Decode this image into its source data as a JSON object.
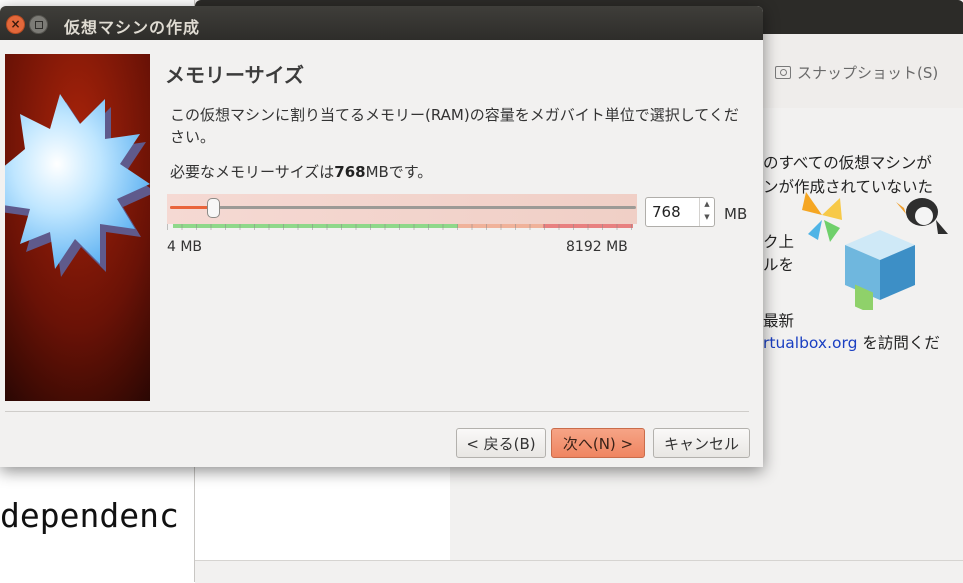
{
  "background": {
    "terminal_text": "dependenc",
    "toolbar_snapshot_label": "スナップショット(S)",
    "welcome_lines": [
      "のすべての仮想マシンが",
      "ンが作成されていないた",
      "ク上",
      "ルを",
      "最新"
    ],
    "welcome_link": "rtualbox.org",
    "welcome_link_suffix": " を訪問くだ"
  },
  "dialog": {
    "title": "仮想マシンの作成",
    "heading": "メモリーサイズ",
    "description": "この仮想マシンに割り当てるメモリー(RAM)の容量をメガバイト単位で選択してください。",
    "recommended_prefix": "必要なメモリーサイズは",
    "recommended_value": "768",
    "recommended_suffix": "MBです。",
    "memory": {
      "value": 768,
      "value_text": "768",
      "min": 4,
      "max": 8192,
      "unit": "MB",
      "min_label": "4 MB",
      "max_label": "8192 MB",
      "zones": {
        "green_end_fraction": 0.62,
        "orange_end_fraction": 0.8
      }
    },
    "buttons": {
      "back": "< 戻る(B)",
      "next": "次へ(N) >",
      "cancel": "キャンセル"
    }
  },
  "colors": {
    "accent": "#e9643b",
    "zone_green": "#8fd88a",
    "zone_orange": "#f0b29a",
    "zone_red": "#e88080",
    "link": "#1a3fc2"
  }
}
